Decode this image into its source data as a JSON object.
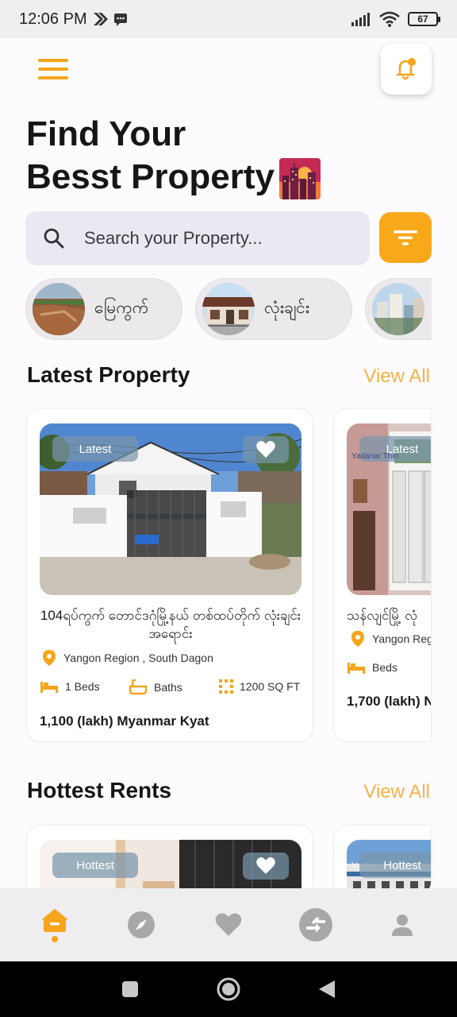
{
  "status_bar": {
    "time": "12:06 PM",
    "battery": "67",
    "icons": [
      "notification-icon",
      "message-icon",
      "signal-icon",
      "wifi-icon",
      "battery-icon"
    ]
  },
  "header": {
    "menu_icon": "hamburger-menu-icon",
    "bell_icon": "notification-bell-icon",
    "title_line1": "Find Your",
    "title_line2": "Besst Property"
  },
  "search": {
    "placeholder": "Search your Property...",
    "icon": "search-icon",
    "filter_icon": "filter-icon"
  },
  "categories": [
    {
      "label": "မြေကွက်"
    },
    {
      "label": "လုံးချင်း"
    },
    {
      "label": ""
    }
  ],
  "latest": {
    "title": "Latest Property",
    "view_all": "View All",
    "cards": [
      {
        "badge": "Latest",
        "title": "104ရပ်ကွက် တောင်ဒဂုံမြို့နယ် တစ်ထပ်တိုက် လုံးချင်းအရောင်း",
        "location": "Yangon Region , South Dagon",
        "beds": "1 Beds",
        "baths": "Baths",
        "area": "1200 SQ FT",
        "price": "1,100 (lakh) Myanmar Kyat"
      },
      {
        "badge": "Latest",
        "watermark": "Yadanar Thin",
        "title": "သန်လျင်မြို့ လုံ",
        "location": "Yangon Regi",
        "beds": "Beds",
        "price": "1,700 (lakh) N"
      }
    ]
  },
  "hottest": {
    "title": "Hottest Rents",
    "view_all": "View All",
    "cards": [
      {
        "badge": "Hottest"
      },
      {
        "badge": "Hottest",
        "watermark": "Yada"
      }
    ]
  },
  "bottom_nav": [
    {
      "icon": "home-icon",
      "active": true
    },
    {
      "icon": "compass-icon",
      "active": false
    },
    {
      "icon": "heart-icon",
      "active": false
    },
    {
      "icon": "compare-arrows-icon",
      "active": false
    },
    {
      "icon": "profile-icon",
      "active": false
    }
  ],
  "colors": {
    "accent": "#f9a81a",
    "view_all": "#f5b347",
    "background": "#fdfbfd"
  }
}
